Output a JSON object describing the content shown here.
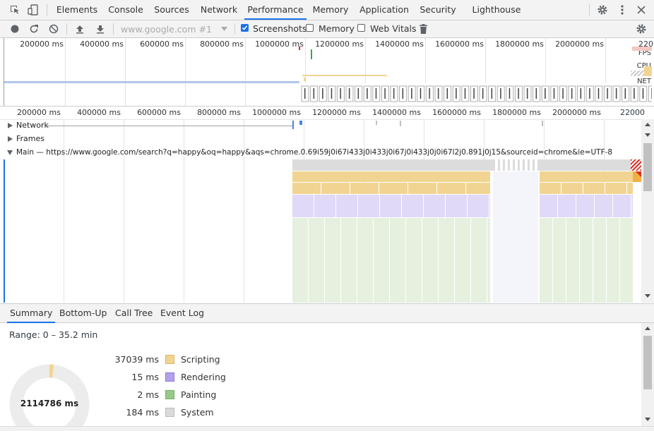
{
  "devtools": {
    "tabs": [
      {
        "label": "Elements"
      },
      {
        "label": "Console"
      },
      {
        "label": "Sources"
      },
      {
        "label": "Network"
      },
      {
        "label": "Performance"
      },
      {
        "label": "Memory"
      },
      {
        "label": "Application"
      },
      {
        "label": "Security"
      },
      {
        "label": "Lighthouse"
      }
    ],
    "active_tab": "Performance"
  },
  "toolbar": {
    "profile_select": "www.google.com #1",
    "screenshots": {
      "label": "Screenshots",
      "checked": true
    },
    "memory": {
      "label": "Memory",
      "checked": false
    },
    "web_vitals": {
      "label": "Web Vitals",
      "checked": false
    }
  },
  "overview": {
    "ticks": [
      "200000 ms",
      "400000 ms",
      "600000 ms",
      "800000 ms",
      "1000000 ms",
      "1200000 ms",
      "1400000 ms",
      "1600000 ms",
      "1800000 ms",
      "2000000 ms",
      "220"
    ],
    "track_labels": {
      "fps": "FPS",
      "cpu": "CPU",
      "net": "NET"
    }
  },
  "flamechart": {
    "ticks": [
      "200000 ms",
      "400000 ms",
      "600000 ms",
      "800000 ms",
      "1000000 ms",
      "1200000 ms",
      "1400000 ms",
      "1600000 ms",
      "1800000 ms",
      "2000000 ms",
      "22000"
    ],
    "tracks": {
      "network": "Network",
      "frames": "Frames",
      "main": "Main — https://www.google.com/search?q=happy&oq=happy&aqs=chrome.0.69i59j0i67i433j0i433j0i67j0i433j0j0i67l2j0.891j0j15&sourceid=chrome&ie=UTF-8"
    }
  },
  "bottom": {
    "tabs": [
      {
        "label": "Summary"
      },
      {
        "label": "Bottom-Up"
      },
      {
        "label": "Call Tree"
      },
      {
        "label": "Event Log"
      }
    ],
    "range": "Range: 0 – 35.2 min",
    "total": "2114786 ms",
    "rows": [
      {
        "value": "37039 ms",
        "label": "Scripting",
        "color": "#f2d492"
      },
      {
        "value": "15 ms",
        "label": "Rendering",
        "color": "#b2a0ea"
      },
      {
        "value": "2 ms",
        "label": "Painting",
        "color": "#97c98a"
      },
      {
        "value": "184 ms",
        "label": "System",
        "color": "#dadada"
      }
    ]
  }
}
